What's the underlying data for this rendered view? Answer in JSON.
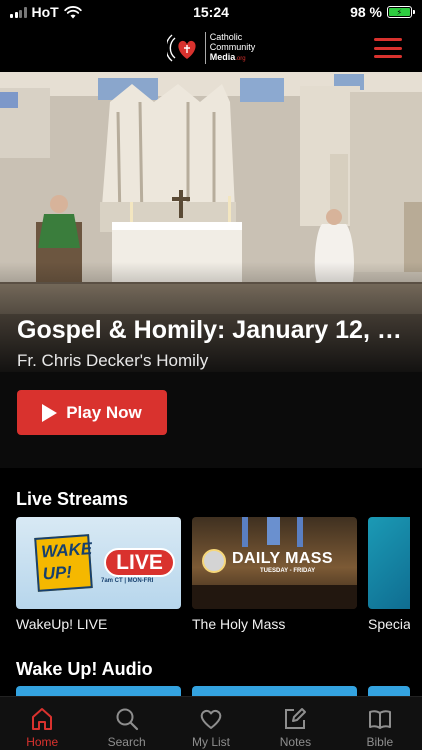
{
  "status_bar": {
    "carrier": "HoT",
    "time": "15:24",
    "battery_percent": "98 %",
    "battery_level": 0.98
  },
  "header": {
    "logo_lines": [
      "Catholic",
      "Community",
      "Media"
    ],
    "logo_org": ".org",
    "menu_icon": "hamburger-menu-icon"
  },
  "hero": {
    "title": "Gospel & Homily: January 12, 2...",
    "subtitle": "Fr. Chris Decker's Homily",
    "play_label": "Play Now",
    "play_icon": "play-icon"
  },
  "live_streams": {
    "title": "Live Streams",
    "items": [
      {
        "label": "WakeUp! LIVE",
        "thumb_logo": "WAKE UP!",
        "thumb_badge": "LIVE",
        "thumb_sub": "7am CT | MON-FRI"
      },
      {
        "label": "The Holy Mass",
        "thumb_title": "DAILY MASS",
        "thumb_sub": "TUESDAY - FRIDAY"
      },
      {
        "label": "Specia"
      }
    ]
  },
  "wake_up_audio": {
    "title": "Wake Up! Audio"
  },
  "tab_bar": {
    "active": "Home",
    "tabs": [
      {
        "label": "Home",
        "icon": "home-icon"
      },
      {
        "label": "Search",
        "icon": "search-icon"
      },
      {
        "label": "My List",
        "icon": "heart-icon"
      },
      {
        "label": "Notes",
        "icon": "edit-note-icon"
      },
      {
        "label": "Bible",
        "icon": "book-icon"
      }
    ]
  },
  "colors": {
    "accent": "#d9322e",
    "background": "#000000",
    "battery": "#2ecc40"
  }
}
